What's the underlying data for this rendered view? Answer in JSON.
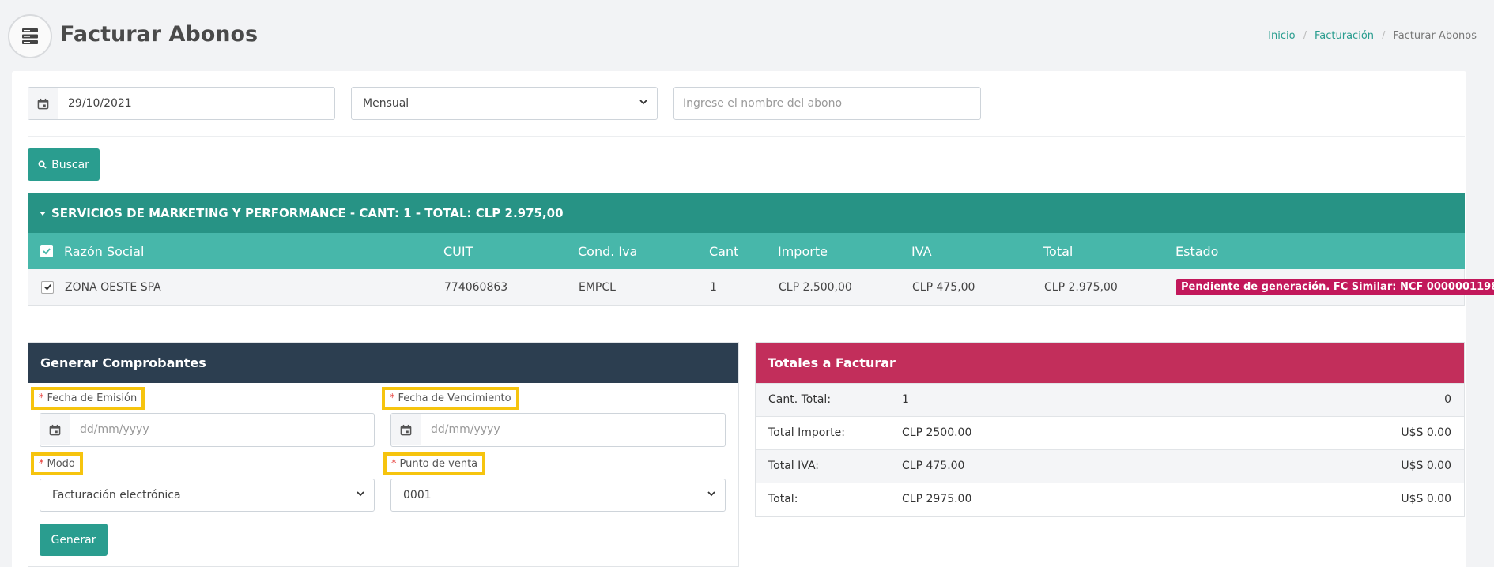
{
  "header": {
    "title": "Facturar Abonos",
    "breadcrumb": [
      "Inicio",
      "Facturación",
      "Facturar Abonos"
    ]
  },
  "filters": {
    "date_value": "29/10/2021",
    "period_value": "Mensual",
    "name_placeholder": "Ingrese el nombre del abono",
    "search_label": "Buscar"
  },
  "group": {
    "title": "SERVICIOS DE MARKETING Y PERFORMANCE - CANT: 1 - TOTAL: CLP 2.975,00"
  },
  "table": {
    "columns": [
      "Razón Social",
      "CUIT",
      "Cond. Iva",
      "Cant",
      "Importe",
      "IVA",
      "Total",
      "Estado"
    ],
    "rows": [
      {
        "razon_social": "ZONA OESTE SPA",
        "cuit": "774060863",
        "cond_iva": "EMPCL",
        "cant": "1",
        "importe": "CLP 2.500,00",
        "iva": "CLP 475,00",
        "total": "CLP 2.975,00",
        "estado": "Pendiente de generación. FC Similar: NCF 0000001198"
      }
    ]
  },
  "generar": {
    "title": "Generar Comprobantes",
    "required_mark": "*",
    "fecha_emision_label": "Fecha de Emisión",
    "fecha_vencimiento_label": "Fecha de Vencimiento",
    "date_placeholder": "dd/mm/yyyy",
    "modo_label": "Modo",
    "modo_value": "Facturación electrónica",
    "punto_label": "Punto de venta",
    "punto_value": "0001",
    "button_label": "Generar"
  },
  "totales": {
    "title": "Totales a Facturar",
    "rows": [
      {
        "label": "Cant. Total:",
        "clp": "1",
        "usd": "0"
      },
      {
        "label": "Total Importe:",
        "clp": "CLP 2500.00",
        "usd": "U$S 0.00"
      },
      {
        "label": "Total IVA:",
        "clp": "CLP 475.00",
        "usd": "U$S 0.00"
      },
      {
        "label": "Total:",
        "clp": "CLP 2975.00",
        "usd": "U$S 0.00"
      }
    ]
  },
  "colors": {
    "teal": "#2a9d8f",
    "table_header": "#47b7aa",
    "dark_panel": "#2c3e50",
    "red_panel": "#c22e5b",
    "badge": "#c2185b",
    "highlight": "#f6c40e"
  }
}
